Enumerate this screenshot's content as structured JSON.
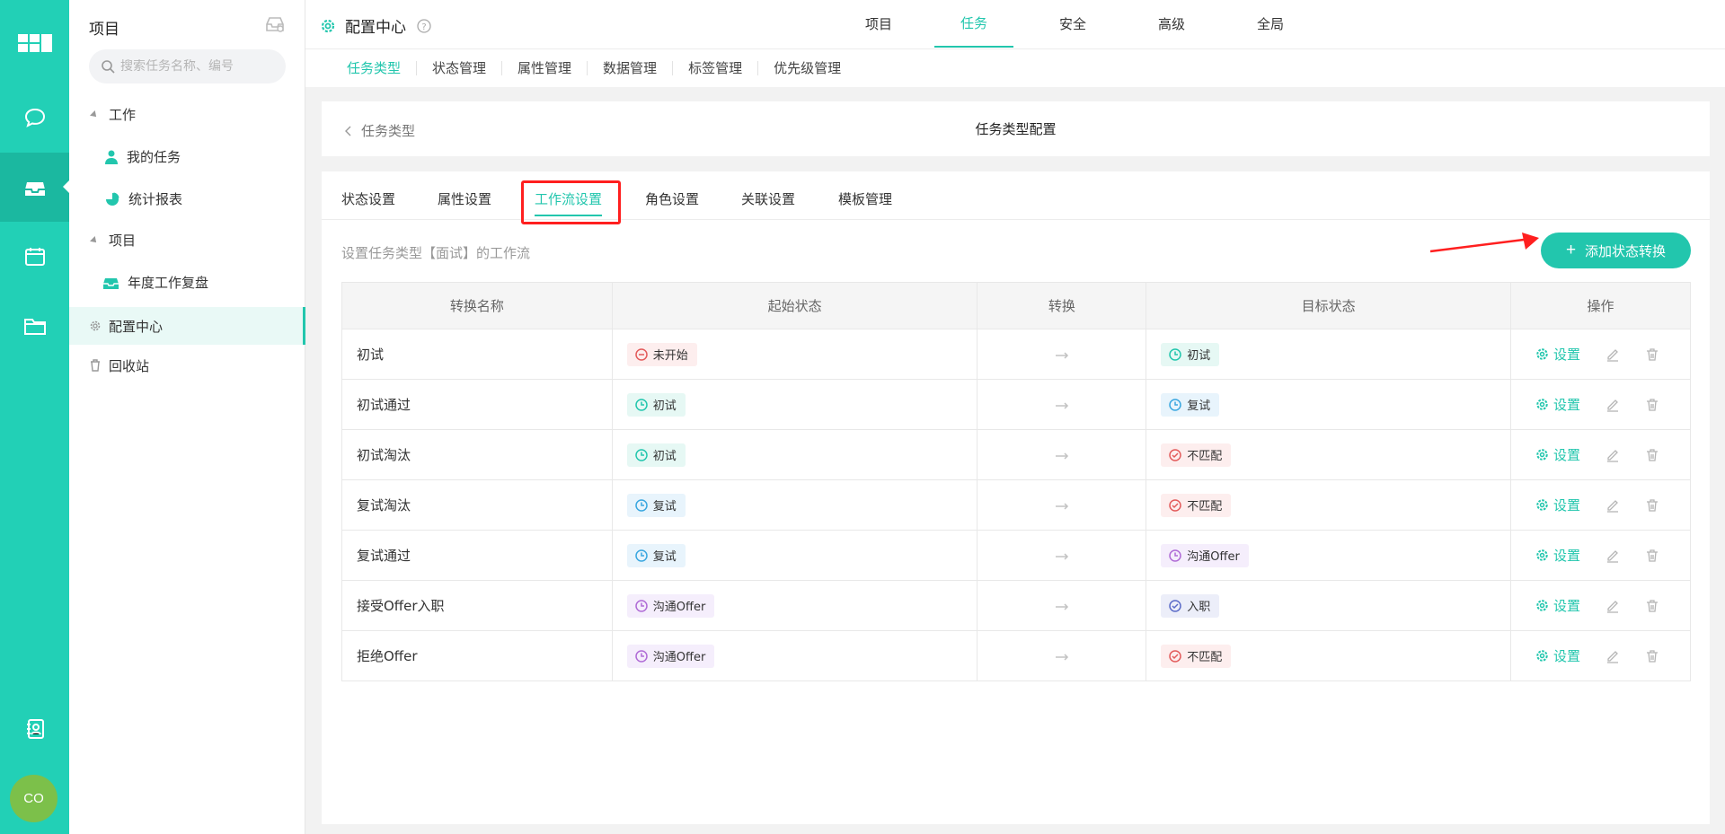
{
  "sidebar": {
    "title": "项目",
    "search_placeholder": "搜索任务名称、编号",
    "groups": [
      {
        "label": "工作"
      },
      {
        "label": "项目"
      }
    ],
    "sub_items": [
      {
        "label": "我的任务",
        "icon": "user-icon"
      },
      {
        "label": "统计报表",
        "icon": "pie-chart-icon"
      },
      {
        "label": "年度工作复盘",
        "icon": "box-icon"
      }
    ],
    "items": [
      {
        "label": "配置中心",
        "icon": "gear-icon",
        "active": true
      },
      {
        "label": "回收站",
        "icon": "trash-icon"
      }
    ]
  },
  "rail": {
    "avatar": "CO"
  },
  "header": {
    "title": "配置中心",
    "tabs": [
      "项目",
      "任务",
      "安全",
      "高级",
      "全局"
    ],
    "active_tab": "任务"
  },
  "subnav": [
    "任务类型",
    "状态管理",
    "属性管理",
    "数据管理",
    "标签管理",
    "优先级管理"
  ],
  "card": {
    "back_label": "任务类型",
    "title": "任务类型配置"
  },
  "tabs": [
    "状态设置",
    "属性设置",
    "工作流设置",
    "角色设置",
    "关联设置",
    "模板管理"
  ],
  "active_tab": "工作流设置",
  "description": "设置任务类型【面试】的工作流",
  "add_button": "添加状态转换",
  "table": {
    "headers": [
      "转换名称",
      "起始状态",
      "转换",
      "目标状态",
      "操作"
    ],
    "rows": [
      {
        "name": "初试",
        "from": "未开始",
        "to": "初试"
      },
      {
        "name": "初试通过",
        "from": "初试",
        "to": "复试"
      },
      {
        "name": "初试淘汰",
        "from": "初试",
        "to": "不匹配"
      },
      {
        "name": "复试淘汰",
        "from": "复试",
        "to": "不匹配"
      },
      {
        "name": "复试通过",
        "from": "复试",
        "to": "沟通Offer"
      },
      {
        "name": "接受Offer入职",
        "from": "沟通Offer",
        "to": "入职"
      },
      {
        "name": "拒绝Offer",
        "from": "沟通Offer",
        "to": "不匹配"
      }
    ],
    "set_label": "设置"
  },
  "status_styles": {
    "未开始": {
      "bg": "#fdeeee",
      "color": "#e35b5b",
      "icon": "minus-circle-icon"
    },
    "初试": {
      "bg": "#e6f8f4",
      "color": "#22c6ad",
      "icon": "clock-icon"
    },
    "复试": {
      "bg": "#e8f4fc",
      "color": "#3aa7e0",
      "icon": "clock-icon"
    },
    "不匹配": {
      "bg": "#fdeeee",
      "color": "#e35b5b",
      "icon": "check-circle-icon"
    },
    "沟通Offer": {
      "bg": "#f5eefc",
      "color": "#b06bd6",
      "icon": "clock-icon"
    },
    "入职": {
      "bg": "#eceef9",
      "color": "#5b6bc8",
      "icon": "check-circle-icon"
    }
  },
  "colors": {
    "accent": "#22c6ad",
    "rail": "#22d0b6",
    "highlight": "#ff1f1f"
  }
}
